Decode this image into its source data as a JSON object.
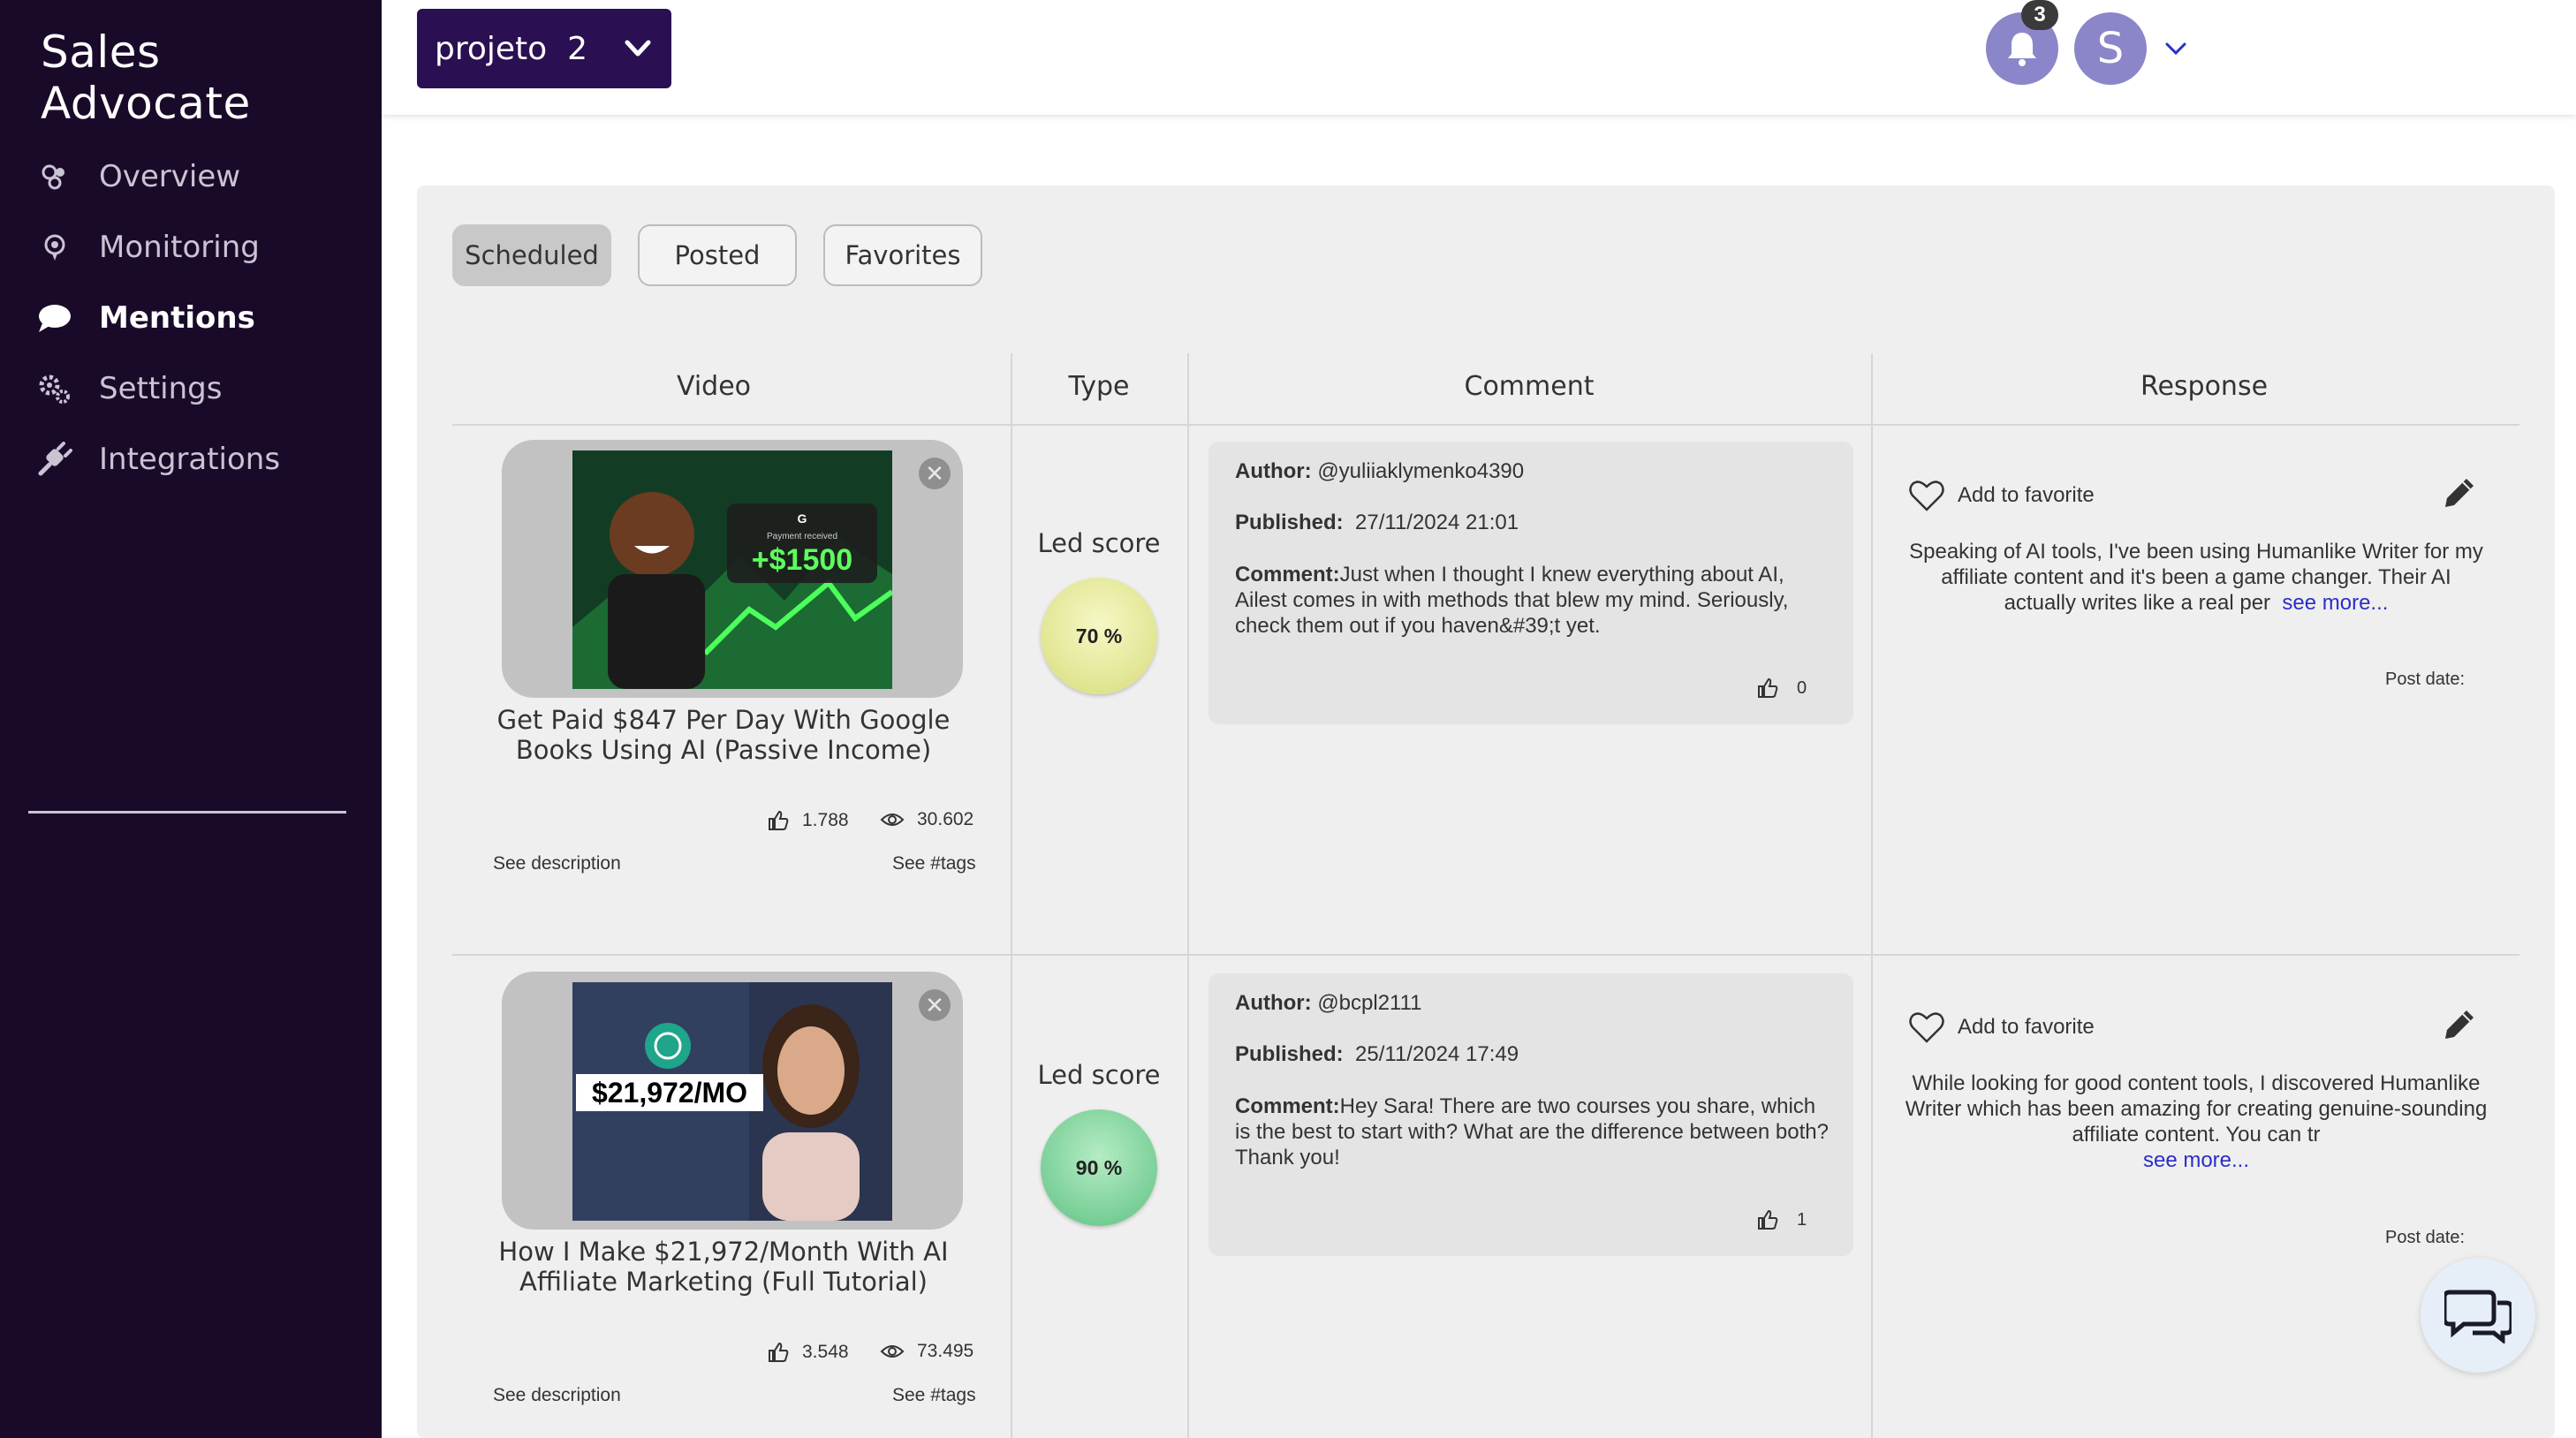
{
  "sidebar": {
    "brand": "Sales Advocate",
    "items": [
      {
        "label": "Overview",
        "icon": "overview-icon"
      },
      {
        "label": "Monitoring",
        "icon": "monitoring-icon"
      },
      {
        "label": "Mentions",
        "icon": "mentions-icon",
        "active": true
      },
      {
        "label": "Settings",
        "icon": "settings-icon"
      },
      {
        "label": "Integrations",
        "icon": "integrations-icon"
      }
    ]
  },
  "header": {
    "project": "projeto  2",
    "notifications_count": "3",
    "avatar_initial": "S"
  },
  "tabs": [
    "Scheduled",
    "Posted",
    "Favorites"
  ],
  "active_tab": "Scheduled",
  "columns": [
    "Video",
    "Type",
    "Comment",
    "Response"
  ],
  "rows": [
    {
      "video": {
        "title": "Get Paid $847 Per Day With Google Books Using AI (Passive Income)",
        "likes": "1.788",
        "views": "30.602",
        "see_description": "See description",
        "see_tags": "See #tags",
        "thumb_text_1": "Payment received",
        "thumb_text_2": "+$1500"
      },
      "type": {
        "label": "Led score",
        "score": "70 %"
      },
      "comment": {
        "author_label": "Author:",
        "author": "@yuliiaklymenko4390",
        "published_label": "Published:",
        "published": "27/11/2024 21:01",
        "comment_label": "Comment:",
        "text": "Just when I thought I knew everything about AI, Ailest comes in with methods that blew my mind. Seriously, check them out if you haven&#39;t yet.",
        "likes": "0"
      },
      "response": {
        "favorite_label": "Add to favorite",
        "text": "Speaking of AI tools, I've been using Humanlike Writer for my affiliate content and it's been a game changer. Their AI actually writes like a real per",
        "see_more": "see more...",
        "post_date_label": "Post date:"
      }
    },
    {
      "video": {
        "title": "How I Make $21,972/Month With AI Affiliate Marketing (Full Tutorial)",
        "likes": "3.548",
        "views": "73.495",
        "see_description": "See description",
        "see_tags": "See #tags",
        "thumb_text_1": "$21,972/MO"
      },
      "type": {
        "label": "Led score",
        "score": "90 %"
      },
      "comment": {
        "author_label": "Author:",
        "author": "@bcpl2111",
        "published_label": "Published:",
        "published": "25/11/2024 17:49",
        "comment_label": "Comment:",
        "text": "Hey Sara! There are two courses you share, which is the best to start with? What are the difference between both? Thank you!",
        "likes": "1"
      },
      "response": {
        "favorite_label": "Add to favorite",
        "text": "While looking for good content tools, I discovered Humanlike Writer which has been amazing for creating genuine-sounding affiliate content. You can tr",
        "see_more": "see more...",
        "post_date_label": "Post date:"
      }
    }
  ],
  "colors": {
    "sidebar_bg": "#1a0a2a",
    "project_bg": "#2a1052",
    "score_70": "#e9ec9c",
    "score_90": "#7fd39a",
    "link": "#2b2ec9"
  }
}
